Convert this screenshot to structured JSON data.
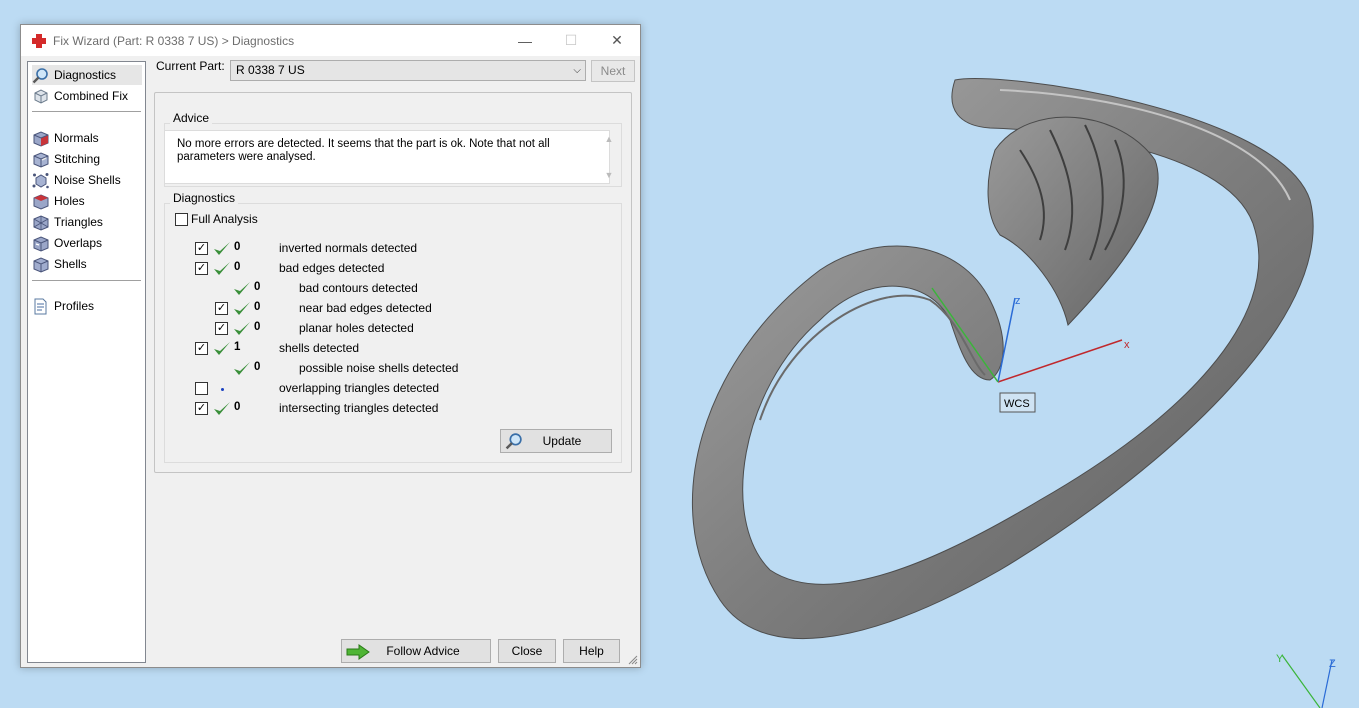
{
  "window": {
    "title": "Fix Wizard (Part: R 0338 7 US) > Diagnostics",
    "min_glyph": "—",
    "max_glyph": "☐",
    "close_glyph": "✕"
  },
  "tools": [
    {
      "label": "Diagnostics",
      "icon": "magnifier-icon",
      "selected": true
    },
    {
      "label": "Combined Fix",
      "icon": "combined-fix-icon"
    },
    {
      "label": "Normals",
      "icon": "normals-cube-icon"
    },
    {
      "label": "Stitching",
      "icon": "stitching-cube-icon"
    },
    {
      "label": "Noise Shells",
      "icon": "noise-shells-icon"
    },
    {
      "label": "Holes",
      "icon": "holes-cube-icon"
    },
    {
      "label": "Triangles",
      "icon": "triangles-cube-icon"
    },
    {
      "label": "Overlaps",
      "icon": "overlaps-cube-icon"
    },
    {
      "label": "Shells",
      "icon": "shells-cube-icon"
    },
    {
      "label": "Profiles",
      "icon": "profiles-document-icon"
    }
  ],
  "part": {
    "label": "Current Part:",
    "value": "R 0338 7 US",
    "next_label": "Next"
  },
  "advice": {
    "title": "Advice",
    "text": "No more errors are detected. It seems that the part is ok. Note that not all parameters were analysed."
  },
  "diagnostics": {
    "title": "Diagnostics",
    "full_analysis_label": "Full Analysis",
    "rows": [
      {
        "checked": true,
        "status": "ok",
        "count": "0",
        "label": "inverted normals detected"
      },
      {
        "checked": true,
        "status": "ok",
        "count": "0",
        "label": "bad edges detected"
      },
      {
        "checked": null,
        "status": "ok",
        "count": "0",
        "label": "bad contours detected"
      },
      {
        "checked": true,
        "status": "ok",
        "count": "0",
        "label": "near bad edges detected"
      },
      {
        "checked": true,
        "status": "ok",
        "count": "0",
        "label": "planar holes detected"
      },
      {
        "checked": true,
        "status": "ok",
        "count": "1",
        "label": "shells detected"
      },
      {
        "checked": null,
        "status": "ok",
        "count": "0",
        "label": "possible noise shells detected"
      },
      {
        "checked": false,
        "status": "not-analysed",
        "count": "",
        "label": "overlapping triangles detected"
      },
      {
        "checked": true,
        "status": "ok",
        "count": "0",
        "label": "intersecting triangles detected"
      }
    ],
    "update_label": "Update"
  },
  "footer": {
    "follow_advice_label": "Follow Advice",
    "close_label": "Close",
    "help_label": "Help"
  },
  "viewport": {
    "axis_x": "x",
    "axis_z": "z",
    "wcs_label": "WCS",
    "corner_y": "Y",
    "corner_z": "Z",
    "colors": {
      "background": "#bcdbf3",
      "axis_x": "#c0282c",
      "axis_y": "#3ab53a",
      "axis_z": "#2a6bd6",
      "model": "#8c8c8c"
    }
  }
}
